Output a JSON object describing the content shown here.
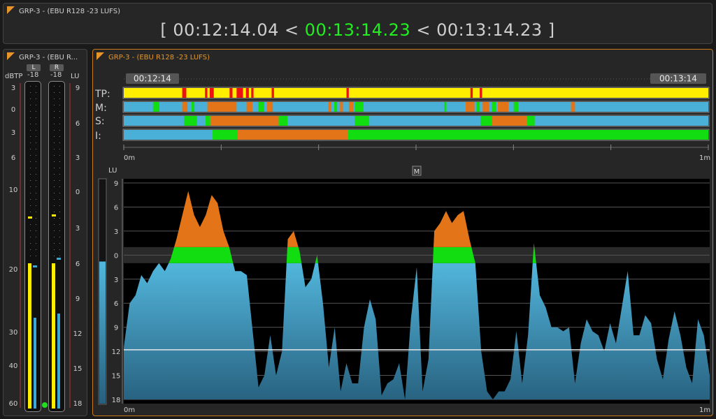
{
  "top_panel": {
    "title": "GRP-3 - (EBU R128 -23 LUFS)",
    "tc_open": "[",
    "tc_start": "00:12:14.04",
    "sep1": "<",
    "tc_current": "00:13:14.23",
    "sep2": "<",
    "tc_end": "00:13:14.23",
    "tc_close": "]"
  },
  "meter_panel": {
    "title": "GRP-3 - (EBU R...",
    "left_unit": "dBTP",
    "right_unit": "LU",
    "channels": [
      {
        "label": "L",
        "value": "-18"
      },
      {
        "label": "R",
        "value": "-18"
      }
    ],
    "dbtp_scale": [
      "3",
      "0",
      "3",
      "6",
      "10",
      "20",
      "30",
      "40",
      "60"
    ],
    "lu_scale": [
      "9",
      "6",
      "3",
      "0",
      "3",
      "6",
      "9",
      "12",
      "15",
      "18"
    ],
    "colors": {
      "peak": "#ffee00",
      "rms": "#3aa8d8",
      "ok_led": "#22dd22"
    }
  },
  "main_panel": {
    "title": "GRP-3 - (EBU R128 -23 LUFS)",
    "start_marker": "00:12:14",
    "end_marker": "00:13:14",
    "lanes": [
      "TP:",
      "M:",
      "S:",
      "I:"
    ],
    "timeline_start": "0m",
    "timeline_end": "1m",
    "mode_button": "M",
    "lu_label": "LU",
    "graph_scale": [
      "9",
      "6",
      "3",
      "0",
      "3",
      "6",
      "9",
      "12",
      "15",
      "18"
    ],
    "graph_start": "0m",
    "graph_end": "1m",
    "colors": {
      "normal": "#4ab0d8",
      "target": "#11dd11",
      "over": "#e37418",
      "peak": "#ffee00",
      "peak_over": "#ee1111"
    }
  },
  "chart_data": {
    "type": "area",
    "xlim": [
      0,
      1
    ],
    "ylim": [
      -18,
      9
    ],
    "target_band": [
      -1,
      1
    ],
    "x": [
      0,
      0.01,
      0.02,
      0.03,
      0.04,
      0.05,
      0.06,
      0.07,
      0.08,
      0.09,
      0.1,
      0.11,
      0.12,
      0.13,
      0.14,
      0.15,
      0.16,
      0.17,
      0.18,
      0.19,
      0.2,
      0.21,
      0.22,
      0.23,
      0.24,
      0.25,
      0.26,
      0.27,
      0.28,
      0.29,
      0.3,
      0.31,
      0.32,
      0.33,
      0.34,
      0.35,
      0.36,
      0.37,
      0.38,
      0.39,
      0.4,
      0.41,
      0.42,
      0.43,
      0.44,
      0.45,
      0.46,
      0.47,
      0.48,
      0.49,
      0.5,
      0.51,
      0.52,
      0.53,
      0.54,
      0.55,
      0.56,
      0.57,
      0.58,
      0.59,
      0.6,
      0.61,
      0.62,
      0.63,
      0.64,
      0.65,
      0.66,
      0.67,
      0.68,
      0.69,
      0.7,
      0.71,
      0.72,
      0.73,
      0.74,
      0.75,
      0.76,
      0.77,
      0.78,
      0.79,
      0.8,
      0.81,
      0.82,
      0.83,
      0.84,
      0.85,
      0.86,
      0.87,
      0.88,
      0.89,
      0.9,
      0.91,
      0.92,
      0.93,
      0.94,
      0.95,
      0.96,
      0.97,
      0.98,
      0.99,
      1.0
    ],
    "momentary_lu": [
      -11.5,
      -6,
      -5,
      -2.5,
      -3.5,
      -2,
      -1,
      -2,
      -0.5,
      2,
      5,
      8,
      5,
      3.5,
      5,
      7.5,
      6.5,
      3,
      1,
      -2,
      -2,
      -2.5,
      -9.5,
      -16.5,
      -15,
      -10,
      -15,
      -12,
      2,
      3,
      0.5,
      -4,
      -3,
      0,
      -6,
      -14,
      -9,
      -17,
      -13.5,
      -16,
      -16,
      -9,
      -5.5,
      -8,
      -17.5,
      -16,
      -15.5,
      -13.5,
      -18,
      -8,
      -1.5,
      -17,
      -13,
      3,
      4,
      5.5,
      4,
      5,
      5.5,
      2,
      -1,
      -12,
      -17,
      -18,
      -17,
      -17,
      -15.5,
      -9.5,
      -16,
      -10,
      1.5,
      -5,
      -6.5,
      -9,
      -9,
      -9.5,
      -9,
      -16,
      -11,
      -8,
      -9.5,
      -10,
      -12,
      -8.5,
      -11,
      -6.5,
      -2,
      -10,
      -10,
      -7.5,
      -8.5,
      -13,
      -15.5,
      -10.5,
      -7,
      -10,
      -14,
      -16,
      -8,
      -10,
      -15
    ]
  }
}
